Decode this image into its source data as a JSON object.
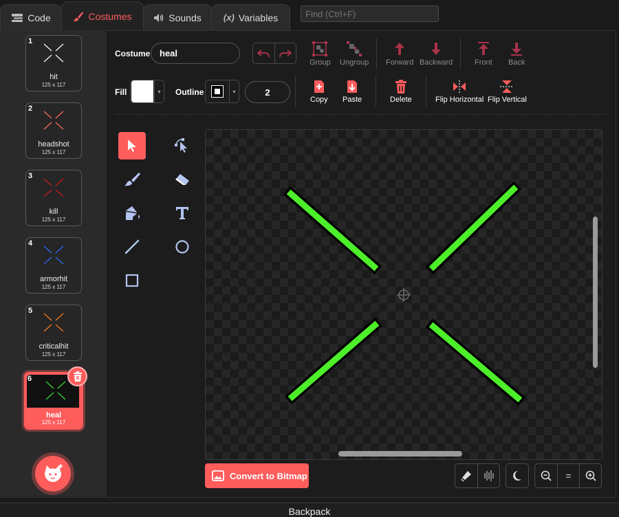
{
  "tabs": [
    {
      "label": "Code",
      "icon": "code-blocks-icon"
    },
    {
      "label": "Costumes",
      "icon": "paintbrush-icon"
    },
    {
      "label": "Sounds",
      "icon": "speaker-icon"
    },
    {
      "label": "Variables",
      "icon": "variables-icon"
    }
  ],
  "active_tab": "Costumes",
  "search": {
    "placeholder": "Find (Ctrl+F)"
  },
  "costumes": [
    {
      "number": "1",
      "name": "hit",
      "size": "125 x 117",
      "color": "#ffffff"
    },
    {
      "number": "2",
      "name": "headshot",
      "size": "125 x 117",
      "color": "#ff6b5b"
    },
    {
      "number": "3",
      "name": "kill",
      "size": "125 x 117",
      "color": "#cc1a1a"
    },
    {
      "number": "4",
      "name": "armorhit",
      "size": "125 x 117",
      "color": "#2e6bff"
    },
    {
      "number": "5",
      "name": "criticalhit",
      "size": "125 x 117",
      "color": "#ff7a1a"
    },
    {
      "number": "6",
      "name": "heal",
      "size": "125 x 117",
      "color": "#33dd33"
    }
  ],
  "selected_costume": "6",
  "toolbar": {
    "costume_label": "Costume",
    "costume_name": "heal",
    "group": "Group",
    "ungroup": "Ungroup",
    "forward": "Forward",
    "backward": "Backward",
    "front": "Front",
    "back": "Back",
    "fill_label": "Fill",
    "fill_color": "#ffffff",
    "outline_label": "Outline",
    "outline_color": "#000000",
    "outline_width": "2",
    "copy": "Copy",
    "paste": "Paste",
    "delete": "Delete",
    "flip_horizontal": "Flip Horizontal",
    "flip_vertical": "Flip Vertical"
  },
  "tools": [
    "select",
    "reshape",
    "brush",
    "eraser",
    "fill",
    "text",
    "line",
    "circle",
    "rectangle"
  ],
  "selected_tool": "select",
  "canvas": {
    "stroke_color": "#4cef29",
    "outline_color": "#000000"
  },
  "bottom": {
    "convert": "Convert to Bitmap",
    "zoom_reset": "="
  },
  "backpack": "Backpack",
  "colors": {
    "accent": "#ff5c5c",
    "inactive_icon": "#a8324a",
    "tool_icon": "#b4c4f0"
  }
}
